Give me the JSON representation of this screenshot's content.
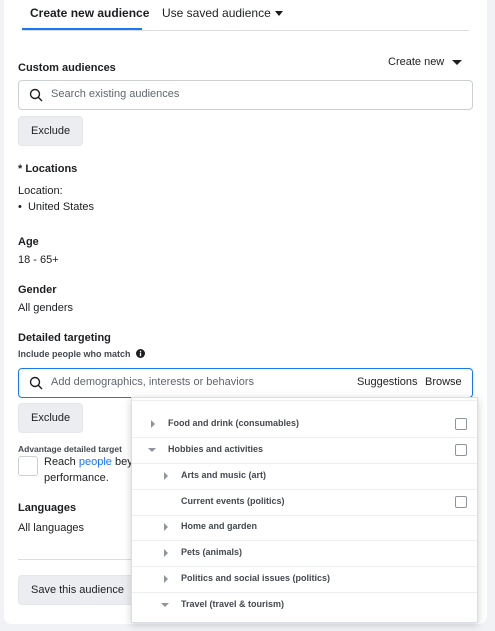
{
  "tabs": {
    "active": "Create new audience",
    "alt": "Use saved audience"
  },
  "custom_audiences": {
    "title": "Custom audiences",
    "create_new": "Create new",
    "search_placeholder": "Search existing audiences",
    "exclude": "Exclude"
  },
  "locations": {
    "title": "* Locations",
    "label": "Location:",
    "value": "United States"
  },
  "age": {
    "title": "Age",
    "value": "18 - 65+"
  },
  "gender": {
    "title": "Gender",
    "value": "All genders"
  },
  "detailed": {
    "title": "Detailed targeting",
    "subtitle": "Include people who match",
    "placeholder": "Add demographics, interests or behaviors",
    "suggestions": "Suggestions",
    "browse": "Browse",
    "exclude": "Exclude"
  },
  "advantage": {
    "title": "Advantage detailed target",
    "line1_pre": "Reach ",
    "line1_link": "people",
    "line1_post": " bey",
    "line2": "performance."
  },
  "languages": {
    "title": "Languages",
    "value": "All languages"
  },
  "save_button": "Save this audience",
  "dropdown": {
    "items": [
      {
        "label": "Food and drink (consumables)"
      },
      {
        "label": "Hobbies and activities"
      },
      {
        "label": "Arts and music (art)"
      },
      {
        "label": "Current events (politics)"
      },
      {
        "label": "Home and garden"
      },
      {
        "label": "Pets (animals)"
      },
      {
        "label": "Politics and social issues (politics)"
      },
      {
        "label": "Travel (travel & tourism)"
      }
    ]
  },
  "colors": {
    "accent": "#1877f2",
    "link": "#1877f2",
    "background": "#f0f2f5"
  }
}
